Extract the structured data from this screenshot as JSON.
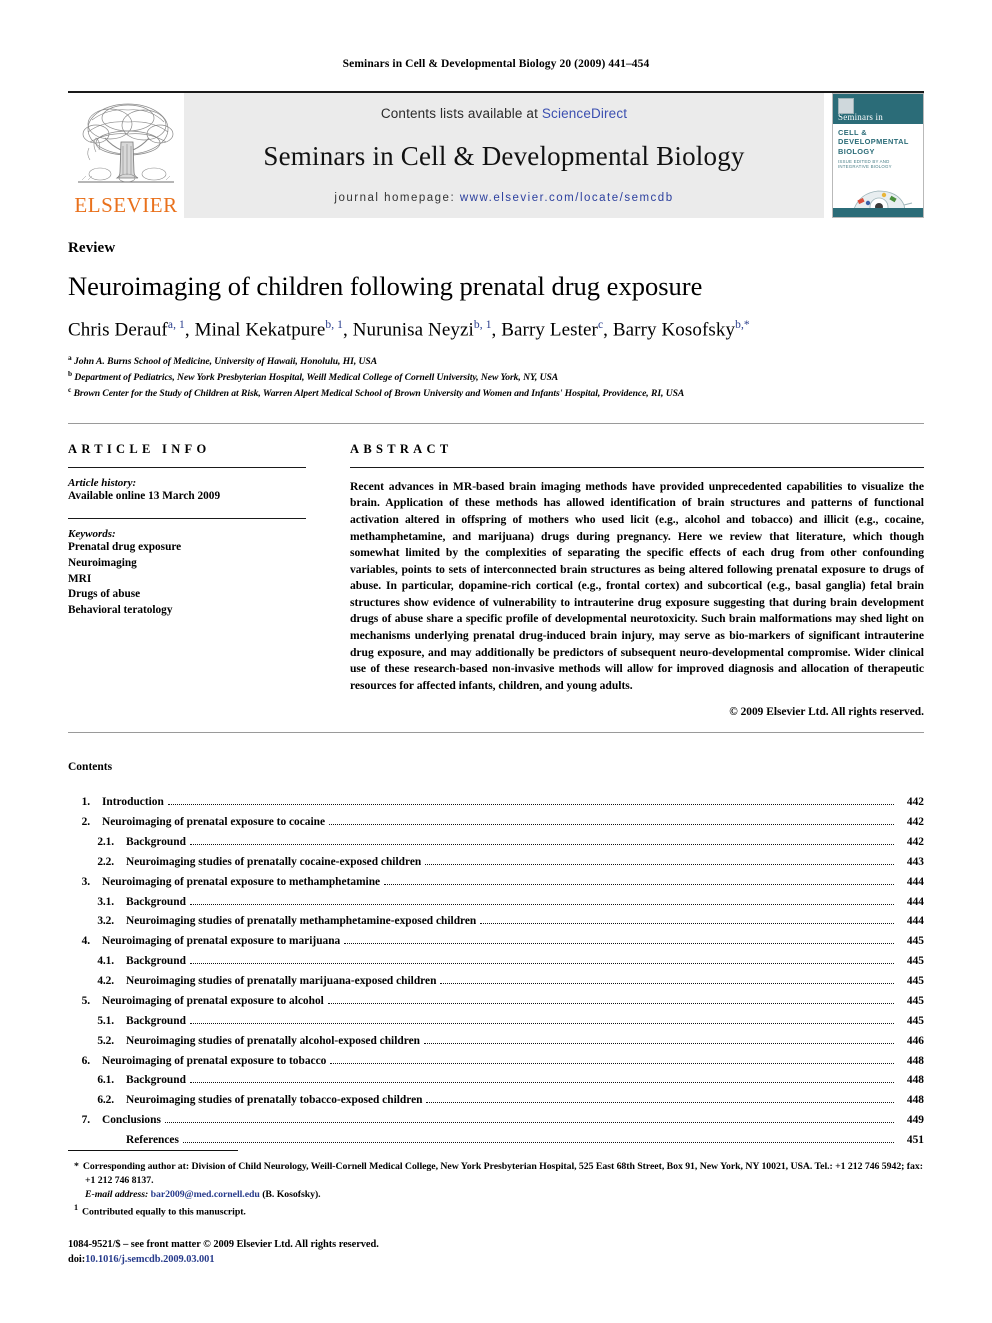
{
  "running_head": "Seminars in Cell & Developmental Biology 20 (2009) 441–454",
  "masthead": {
    "contents_prefix": "Contents lists available at ",
    "sciencedirect": "ScienceDirect",
    "journal_title": "Seminars in Cell & Developmental Biology",
    "homepage_prefix": "journal homepage:",
    "homepage_url": "www.elsevier.com/locate/semcdb",
    "publisher": "ELSEVIER",
    "publisher_color": "#E9711C",
    "cover": {
      "seminars_in": "Seminars in",
      "main": "CELL & DEVELOPMENTAL BIOLOGY",
      "sub": "ISSUE EDITED BY AND INTEGRATIVE BIOLOGY",
      "band_color": "#2b6c78"
    },
    "link_color": "#3b4fb0"
  },
  "article": {
    "type": "Review",
    "title": "Neuroimaging of children following prenatal drug exposure",
    "authors": [
      {
        "name": "Chris Derauf",
        "sup": "a, 1",
        "sep": ", "
      },
      {
        "name": "Minal Kekatpure",
        "sup": "b, 1",
        "sep": ", "
      },
      {
        "name": "Nurunisa Neyzi",
        "sup": "b, 1",
        "sep": ", "
      },
      {
        "name": "Barry Lester",
        "sup": "c",
        "sep": ", "
      },
      {
        "name": "Barry Kosofsky",
        "sup": "b,*",
        "sep": ""
      }
    ],
    "affiliations": [
      {
        "mark": "a",
        "text": "John A. Burns School of Medicine, University of Hawaii, Honolulu, HI, USA"
      },
      {
        "mark": "b",
        "text": "Department of Pediatrics, New York Presbyterian Hospital, Weill Medical College of Cornell University, New York, NY, USA"
      },
      {
        "mark": "c",
        "text": "Brown Center for the Study of Children at Risk, Warren Alpert Medical School of Brown University and Women and Infants' Hospital, Providence, RI, USA"
      }
    ]
  },
  "article_info": {
    "heading": "ARTICLE INFO",
    "history_label": "Article history:",
    "history_value": "Available online 13 March 2009",
    "keywords_label": "Keywords:",
    "keywords": [
      "Prenatal drug exposure",
      "Neuroimaging",
      "MRI",
      "Drugs of abuse",
      "Behavioral teratology"
    ]
  },
  "abstract": {
    "heading": "ABSTRACT",
    "body": "Recent advances in MR-based brain imaging methods have provided unprecedented capabilities to visualize the brain. Application of these methods has allowed identification of brain structures and patterns of functional activation altered in offspring of mothers who used licit (e.g., alcohol and tobacco) and illicit (e.g., cocaine, methamphetamine, and marijuana) drugs during pregnancy. Here we review that literature, which though somewhat limited by the complexities of separating the specific effects of each drug from other confounding variables, points to sets of interconnected brain structures as being altered following prenatal exposure to drugs of abuse. In particular, dopamine-rich cortical (e.g., frontal cortex) and subcortical (e.g., basal ganglia) fetal brain structures show evidence of vulnerability to intrauterine drug exposure suggesting that during brain development drugs of abuse share a specific profile of developmental neurotoxicity. Such brain malformations may shed light on mechanisms underlying prenatal drug-induced brain injury, may serve as bio-markers of significant intrauterine drug exposure, and may additionally be predictors of subsequent neuro-developmental compromise. Wider clinical use of these research-based non-invasive methods will allow for improved diagnosis and allocation of therapeutic resources for affected infants, children, and young adults.",
    "copyright": "© 2009 Elsevier Ltd. All rights reserved."
  },
  "contents": {
    "heading": "Contents",
    "entries": [
      {
        "level": 1,
        "num": "1.",
        "label": "Introduction",
        "page": "442"
      },
      {
        "level": 1,
        "num": "2.",
        "label": "Neuroimaging of prenatal exposure to cocaine",
        "page": "442"
      },
      {
        "level": 2,
        "num": "2.1.",
        "label": "Background",
        "page": "442"
      },
      {
        "level": 2,
        "num": "2.2.",
        "label": "Neuroimaging studies of prenatally cocaine-exposed children",
        "page": "443"
      },
      {
        "level": 1,
        "num": "3.",
        "label": "Neuroimaging of prenatal exposure to methamphetamine",
        "page": "444"
      },
      {
        "level": 2,
        "num": "3.1.",
        "label": "Background",
        "page": "444"
      },
      {
        "level": 2,
        "num": "3.2.",
        "label": "Neuroimaging studies of prenatally methamphetamine-exposed children",
        "page": "444"
      },
      {
        "level": 1,
        "num": "4.",
        "label": "Neuroimaging of prenatal exposure to marijuana",
        "page": "445"
      },
      {
        "level": 2,
        "num": "4.1.",
        "label": "Background",
        "page": "445"
      },
      {
        "level": 2,
        "num": "4.2.",
        "label": "Neuroimaging studies of prenatally marijuana-exposed children",
        "page": "445"
      },
      {
        "level": 1,
        "num": "5.",
        "label": "Neuroimaging of prenatal exposure to alcohol",
        "page": "445"
      },
      {
        "level": 2,
        "num": "5.1.",
        "label": "Background",
        "page": "445"
      },
      {
        "level": 2,
        "num": "5.2.",
        "label": "Neuroimaging studies of prenatally alcohol-exposed children",
        "page": "446"
      },
      {
        "level": 1,
        "num": "6.",
        "label": "Neuroimaging of prenatal exposure to tobacco",
        "page": "448"
      },
      {
        "level": 2,
        "num": "6.1.",
        "label": "Background",
        "page": "448"
      },
      {
        "level": 2,
        "num": "6.2.",
        "label": "Neuroimaging studies of prenatally tobacco-exposed children",
        "page": "448"
      },
      {
        "level": 1,
        "num": "7.",
        "label": "Conclusions",
        "page": "449"
      },
      {
        "level": 0,
        "num": "",
        "label": "References",
        "page": "451"
      }
    ]
  },
  "footnotes": {
    "corresponding_mark": "*",
    "corresponding_text": "Corresponding author at: Division of Child Neurology, Weill-Cornell Medical College, New York Presbyterian Hospital, 525 East 68th Street, Box 91, New York, NY 10021, USA. Tel.: +1 212 746 5942; fax: +1 212 746 8137.",
    "email_label": "E-mail address:",
    "email": "bar2009@med.cornell.edu",
    "email_owner": "(B. Kosofsky).",
    "equal_mark": "1",
    "equal_text": "Contributed equally to this manuscript.",
    "issn_line": "1084-9521/$ – see front matter © 2009 Elsevier Ltd. All rights reserved.",
    "doi_label": "doi:",
    "doi_value": "10.1016/j.semcdb.2009.03.001",
    "link_color": "#283c8c"
  }
}
